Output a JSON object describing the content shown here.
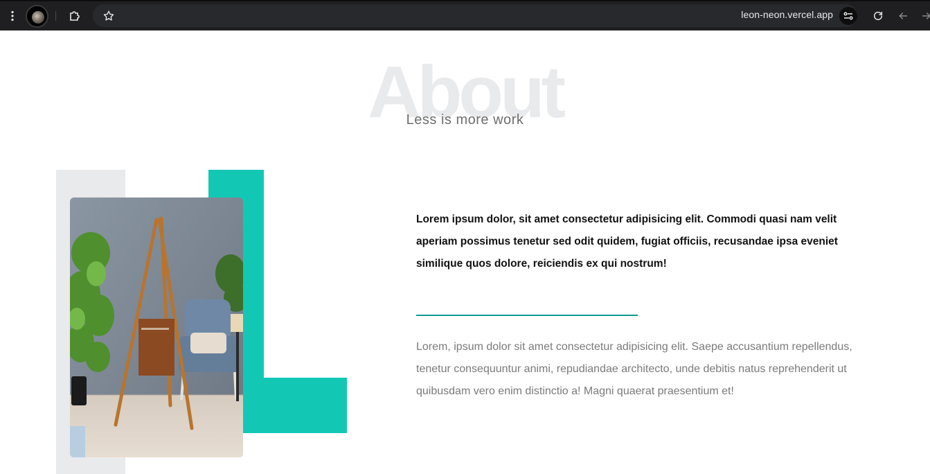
{
  "browser": {
    "url": "leon-neon.vercel.app",
    "icons": {
      "menu": "vertical-dots-icon",
      "profile": "avatar",
      "extensions": "puzzle-icon",
      "bookmark": "star-icon",
      "site_settings": "tune-icon",
      "reload": "reload-icon",
      "back": "arrow-left-icon",
      "forward": "arrow-right-icon"
    }
  },
  "about": {
    "title": "About",
    "subtitle": "Less is more work"
  },
  "content": {
    "lead": "Lorem ipsum dolor, sit amet consectetur adipisicing elit. Commodi quasi nam velit aperiam possimus tenetur sed odit quidem, fugiat officiis, recusandae ipsa eveniet similique quos dolore, reiciendis ex qui nostrum!",
    "body": "Lorem, ipsum dolor sit amet consectetur adipisicing elit. Saepe accusantium repellendus, tenetur consequuntur animi, repudiandae architecto, unde debitis natus reprehenderit ut quibusdam vero enim distinctio a! Magni quaerat praesentium et!"
  },
  "colors": {
    "accent": "#12c8b5",
    "rule": "#0f9b8e",
    "title_ghost": "#e9eaec",
    "toolbar": "#1f1f22"
  }
}
